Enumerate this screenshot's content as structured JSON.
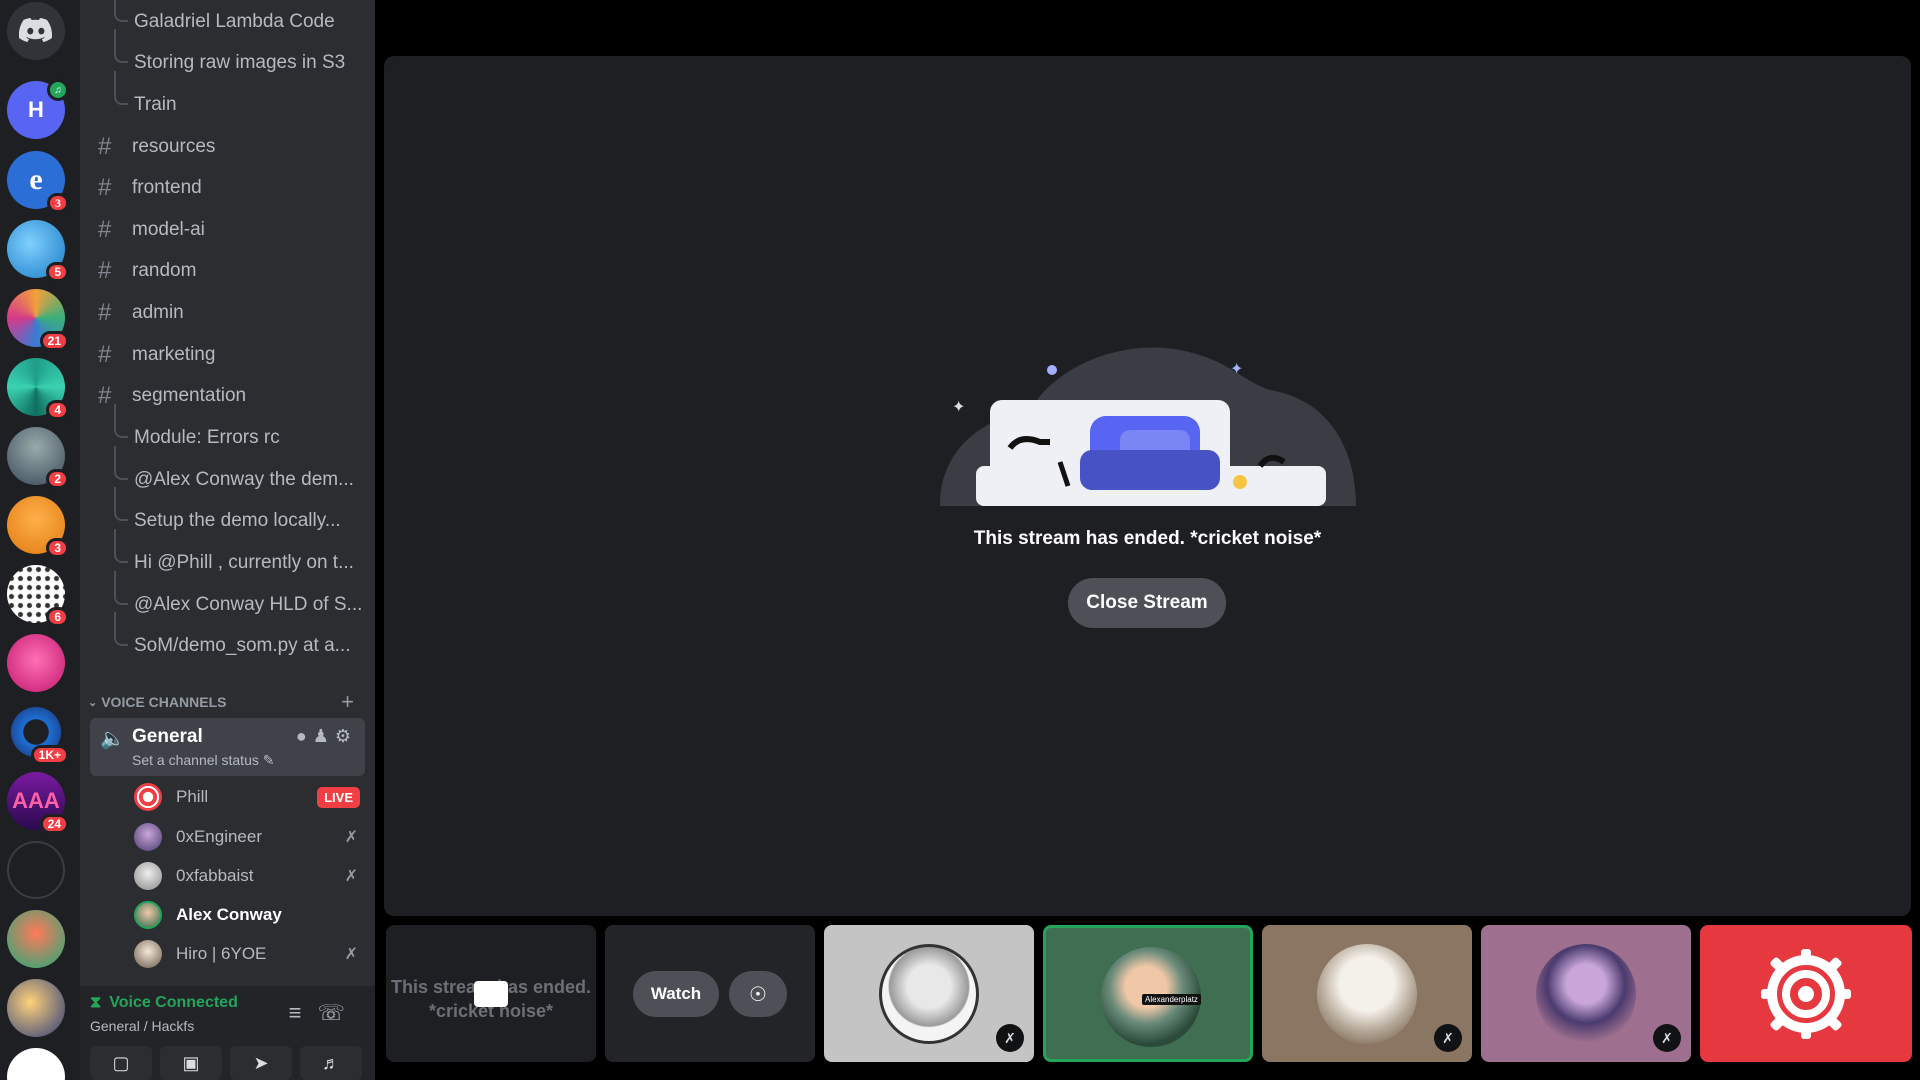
{
  "servers": [
    {
      "letter": "",
      "badge": "",
      "color": "#313338"
    },
    {
      "letter": "H",
      "badge": "",
      "color": "#5865f2"
    },
    {
      "letter": "e",
      "badge": "3",
      "color": "#2b6fd6"
    },
    {
      "letter": "",
      "badge": "5",
      "color": "#1a7bc4"
    },
    {
      "letter": "",
      "badge": "21",
      "color": "#3b6e8f"
    },
    {
      "letter": "",
      "badge": "4",
      "color": "#1f9e8a"
    },
    {
      "letter": "",
      "badge": "2",
      "color": "#5a6b7c"
    },
    {
      "letter": "",
      "badge": "3",
      "color": "#f0a020"
    },
    {
      "letter": "",
      "badge": "6",
      "color": "#ffffff"
    },
    {
      "letter": "",
      "badge": "",
      "color": "#d23a8c"
    },
    {
      "letter": "",
      "badge": "1K+",
      "color": "#1d4fa0"
    },
    {
      "letter": "AAA",
      "badge": "24",
      "color": "#4a1a6e"
    },
    {
      "letter": "",
      "badge": "",
      "color": "#1e1f22"
    },
    {
      "letter": "",
      "badge": "",
      "color": "#e0873a"
    },
    {
      "letter": "",
      "badge": "",
      "color": "#2a3a7a"
    },
    {
      "letter": "",
      "badge": "",
      "color": "#ffffff"
    }
  ],
  "sidebar": {
    "threads_top": [
      "Galadriel Lambda Code",
      "Storing raw images in S3",
      "Train"
    ],
    "channels": [
      "resources",
      "frontend",
      "model-ai",
      "random",
      "admin",
      "marketing",
      "segmentation"
    ],
    "threads": [
      "Module: Errors rc",
      "@Alex Conway the dem...",
      "Setup the demo locally...",
      "Hi @Phill , currently on t...",
      "@Alex Conway HLD of S...",
      "SoM/demo_som.py at a..."
    ],
    "voice_header": "VOICE CHANNELS",
    "voice_channel": {
      "name": "General",
      "status": "Set a channel status"
    },
    "members": [
      {
        "name": "Phill",
        "live": "LIVE",
        "muted": false,
        "color": "#f23f43"
      },
      {
        "name": "0xEngineer",
        "live": "",
        "muted": true,
        "color": "#6b5b95"
      },
      {
        "name": "0xfabbaist",
        "live": "",
        "muted": true,
        "color": "#c8c8c8"
      },
      {
        "name": "Alex Conway",
        "live": "",
        "muted": false,
        "color": "#4a8a6a"
      },
      {
        "name": "Hiro | 6YOE",
        "live": "",
        "muted": true,
        "color": "#8a7a6a"
      }
    ]
  },
  "userbar": {
    "status": "Voice Connected",
    "location": "General / Hackfs"
  },
  "stage": {
    "ended_text": "This stream has ended. *cricket noise*",
    "close_label": "Close Stream"
  },
  "tiles": {
    "ended_text": "This stream has ended. *cricket noise*",
    "watch_label": "Watch",
    "name_tag": "Alexanderplatz"
  }
}
